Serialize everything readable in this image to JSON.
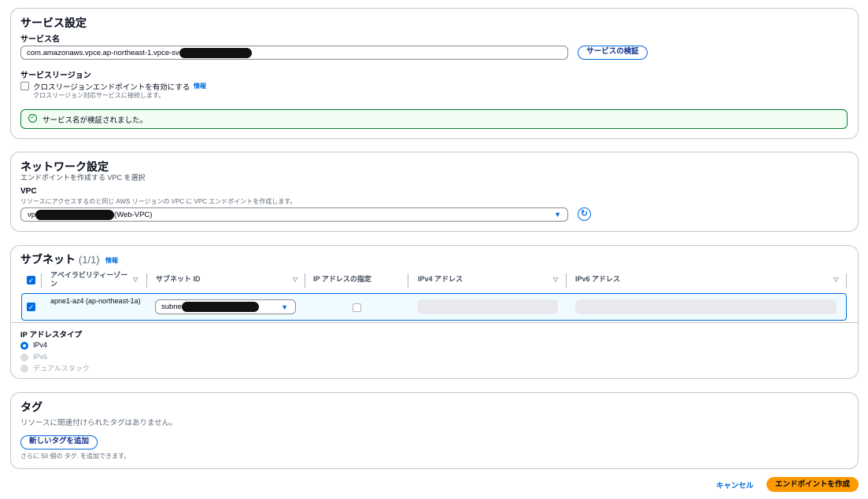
{
  "service": {
    "title": "サービス設定",
    "name_label": "サービス名",
    "name_value": "com.amazonaws.vpce.ap-northeast-1.vpce-sv",
    "verify_button": "サービスの検証",
    "region_label": "サービスリージョン",
    "cross_region_label": "クロスリージョンエンドポイントを有効にする",
    "info": "情報",
    "cross_region_desc": "クロスリージョン対応サービスに接続します。",
    "verified_message": "サービス名が検証されました。"
  },
  "network": {
    "title": "ネットワーク設定",
    "desc": "エンドポイントを作成する VPC を選択",
    "vpc_label": "VPC",
    "vpc_desc": "リソースにアクセスするのと同じ AWS リージョンの VPC に VPC エンドポイントを作成します。",
    "vpc_prefix": "vp",
    "vpc_suffix": "(Web-VPC)"
  },
  "subnets": {
    "title": "サブネット",
    "count": "(1/1)",
    "info": "情報",
    "columns": [
      "アベイラビリティーゾーン",
      "サブネット ID",
      "IP アドレスの指定",
      "IPv4 アドレス",
      "IPv6 アドレス"
    ],
    "rows": [
      {
        "az": "apne1-az4 (ap-northeast-1a)",
        "subnet_prefix": "subne"
      }
    ]
  },
  "ip_type": {
    "label": "IP アドレスタイプ",
    "options": [
      "IPv4",
      "IPv6",
      "デュアルスタック"
    ],
    "selected": "IPv4"
  },
  "tags": {
    "title": "タグ",
    "empty": "リソースに関連付けられたタグはありません。",
    "add_button": "新しいタグを追加",
    "hint": "さらに 50 個の タグ. を追加できます。"
  },
  "footer": {
    "cancel": "キャンセル",
    "create": "エンドポイントを作成"
  },
  "colors": {
    "accent": "#006ce0",
    "success": "#00802f",
    "primary": "#ff9900"
  }
}
